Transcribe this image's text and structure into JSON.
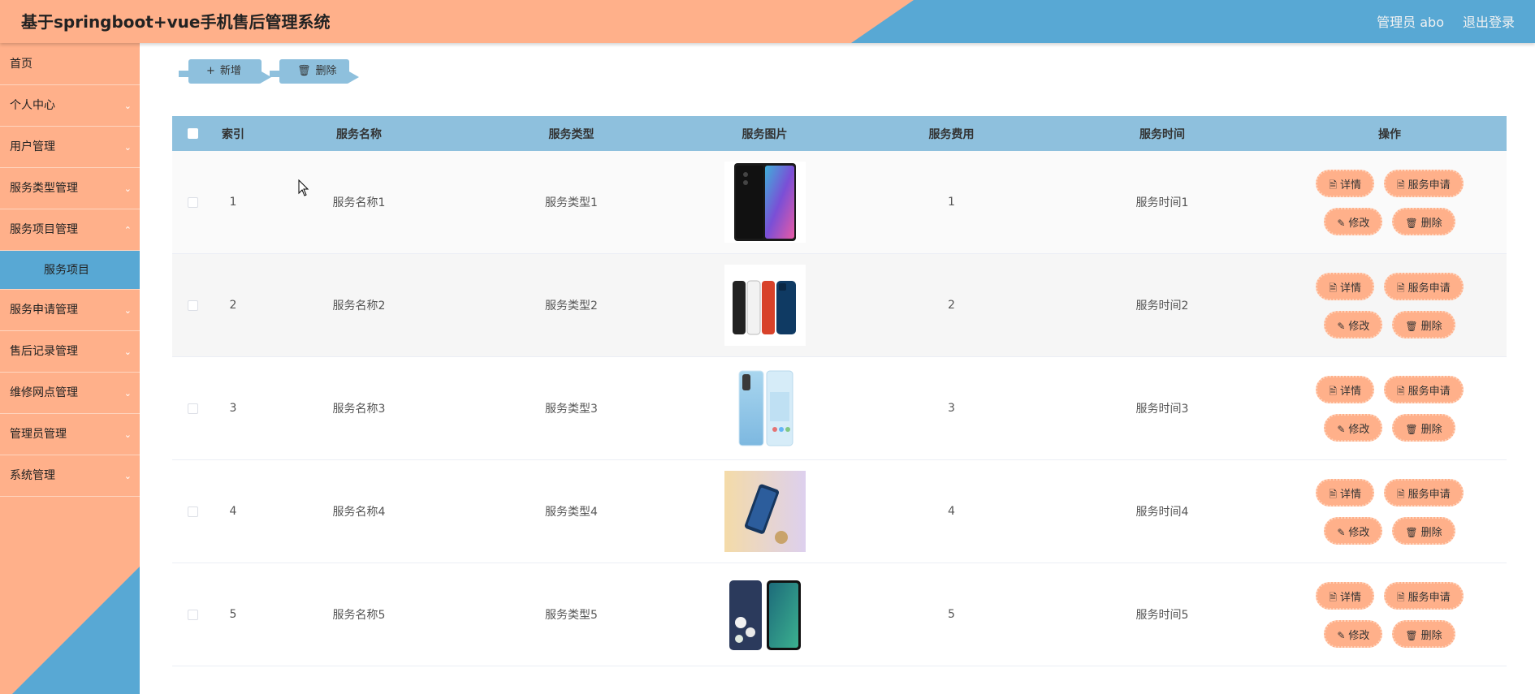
{
  "header": {
    "title": "基于springboot+vue手机售后管理系统",
    "user": "管理员 abo",
    "logout": "退出登录",
    "colors": {
      "peach": "#ffb08a",
      "blue": "#58a8d4"
    }
  },
  "sidebar": {
    "items": [
      {
        "label": "首页"
      },
      {
        "label": "个人中心"
      },
      {
        "label": "用户管理"
      },
      {
        "label": "服务类型管理"
      },
      {
        "label": "服务项目管理"
      },
      {
        "label": "服务项目"
      },
      {
        "label": "服务申请管理"
      },
      {
        "label": "售后记录管理"
      },
      {
        "label": "维修网点管理"
      },
      {
        "label": "管理员管理"
      },
      {
        "label": "系统管理"
      }
    ]
  },
  "toolbar": {
    "add_label": "新增",
    "delete_label": "删除"
  },
  "table": {
    "headers": {
      "index": "索引",
      "name": "服务名称",
      "type": "服务类型",
      "image": "服务图片",
      "fee": "服务费用",
      "time": "服务时间",
      "ops": "操作"
    },
    "ops": {
      "detail": "详情",
      "apply": "服务申请",
      "edit": "修改",
      "delete": "删除"
    },
    "rows": [
      {
        "index": "1",
        "name": "服务名称1",
        "type": "服务类型1",
        "fee": "1",
        "time": "服务时间1",
        "image": "phone-front"
      },
      {
        "index": "2",
        "name": "服务名称2",
        "type": "服务类型2",
        "fee": "2",
        "time": "服务时间2",
        "image": "phones-colors"
      },
      {
        "index": "3",
        "name": "服务名称3",
        "type": "服务类型3",
        "fee": "3",
        "time": "服务时间3",
        "image": "phone-blue"
      },
      {
        "index": "4",
        "name": "服务名称4",
        "type": "服务类型4",
        "fee": "4",
        "time": "服务时间4",
        "image": "phone-hand"
      },
      {
        "index": "5",
        "name": "服务名称5",
        "type": "服务类型5",
        "fee": "5",
        "time": "服务时间5",
        "image": "phones-floral"
      }
    ]
  }
}
